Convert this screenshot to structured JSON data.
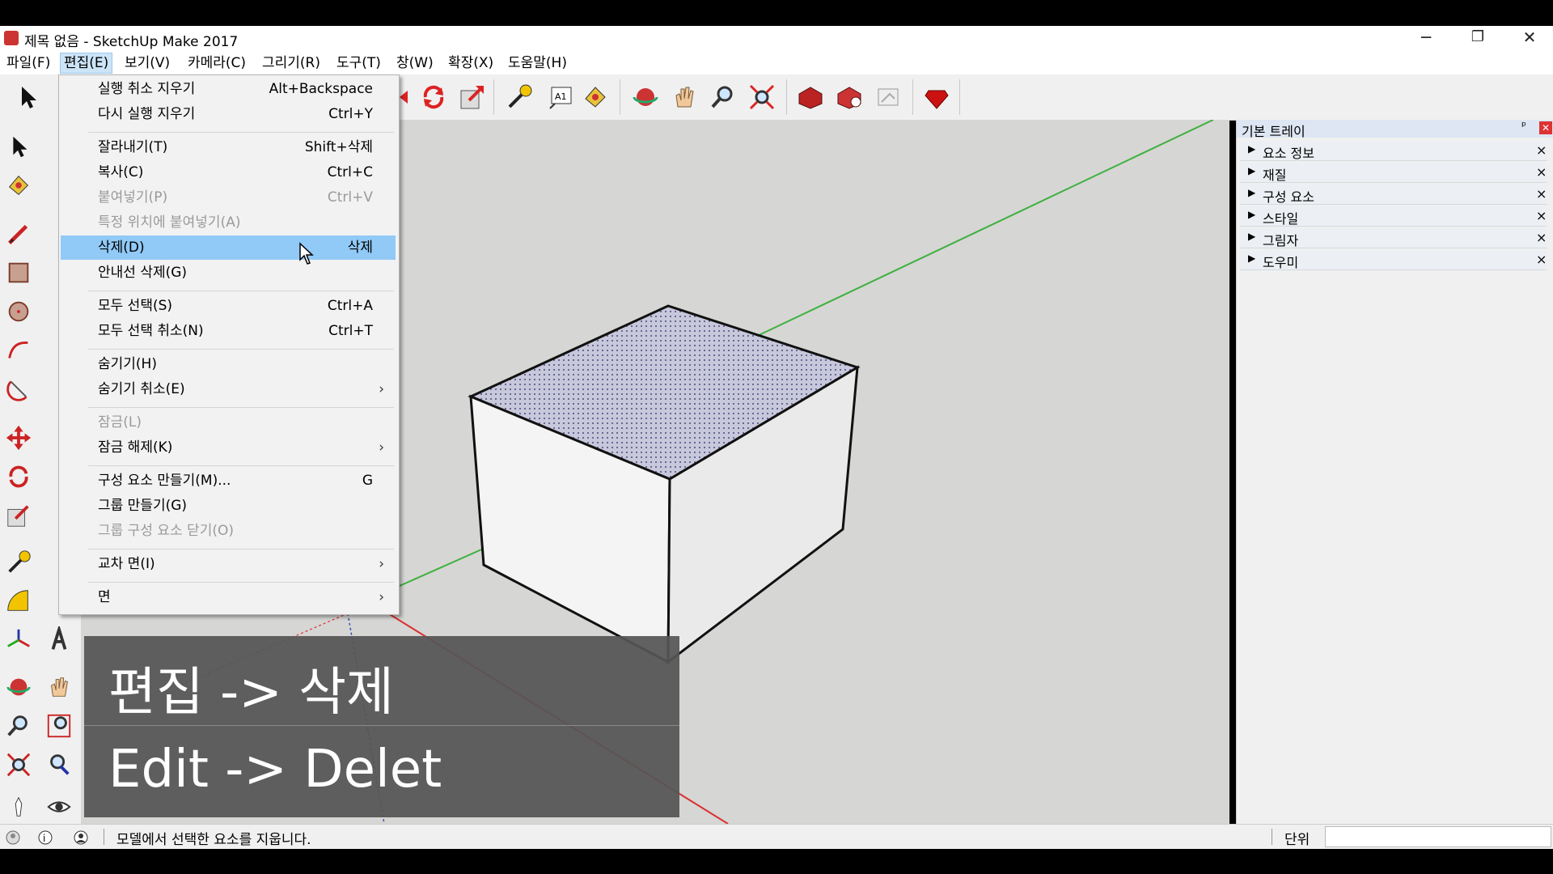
{
  "window": {
    "title": "제목 없음 - SketchUp Make 2017",
    "minimize": "─",
    "restore": "❐",
    "close": "✕"
  },
  "menubar": {
    "items": [
      "파일(F)",
      "편집(E)",
      "보기(V)",
      "카메라(C)",
      "그리기(R)",
      "도구(T)",
      "창(W)",
      "확장(X)",
      "도움말(H)"
    ],
    "active": "편집(E)"
  },
  "edit_menu": {
    "items": [
      {
        "label": "실행 취소 지우기",
        "shortcut": "Alt+Backspace"
      },
      {
        "label": "다시 실행 지우기",
        "shortcut": "Ctrl+Y"
      },
      {
        "label": "잘라내기(T)",
        "shortcut": "Shift+삭제"
      },
      {
        "label": "복사(C)",
        "shortcut": "Ctrl+C"
      },
      {
        "label": "붙여넣기(P)",
        "shortcut": "Ctrl+V",
        "disabled": true
      },
      {
        "label": "특정 위치에 붙여넣기(A)",
        "shortcut": "",
        "disabled": true
      },
      {
        "label": "삭제(D)",
        "shortcut": "삭제",
        "highlighted": true
      },
      {
        "label": "안내선 삭제(G)",
        "shortcut": ""
      },
      {
        "label": "모두 선택(S)",
        "shortcut": "Ctrl+A"
      },
      {
        "label": "모두 선택 취소(N)",
        "shortcut": "Ctrl+T"
      },
      {
        "label": "숨기기(H)",
        "shortcut": ""
      },
      {
        "label": "숨기기 취소(E)",
        "shortcut": "",
        "submenu": true
      },
      {
        "label": "잠금(L)",
        "shortcut": "",
        "disabled": true
      },
      {
        "label": "잠금 해제(K)",
        "shortcut": "",
        "submenu": true
      },
      {
        "label": "구성 요소 만들기(M)...",
        "shortcut": "G"
      },
      {
        "label": "그룹 만들기(G)",
        "shortcut": ""
      },
      {
        "label": "그룹 구성 요소 닫기(O)",
        "shortcut": "",
        "disabled": true
      },
      {
        "label": "교차 면(I)",
        "shortcut": "",
        "submenu": true
      },
      {
        "label": "면",
        "shortcut": "",
        "submenu": true
      }
    ],
    "submenu_arrow": "›"
  },
  "tray": {
    "title": "기본 트레이",
    "pin": "ᵖ",
    "close": "✕",
    "panels": [
      "요소 정보",
      "재질",
      "구성 요소",
      "스타일",
      "그림자",
      "도우미"
    ],
    "expander": "▶",
    "panel_close": "×"
  },
  "caption": {
    "line1": "편집 -> 삭제",
    "line2": "Edit -> Delet"
  },
  "statusbar": {
    "message": "모델에서 선택한 요소를 지웁니다.",
    "units_label": "단위"
  },
  "colors": {
    "accent_highlight": "#91c9f7",
    "axis_green": "#3fb03f",
    "axis_red": "#d93030",
    "axis_blue": "#3a50b0",
    "viewport_bg": "#d6d6d4"
  }
}
